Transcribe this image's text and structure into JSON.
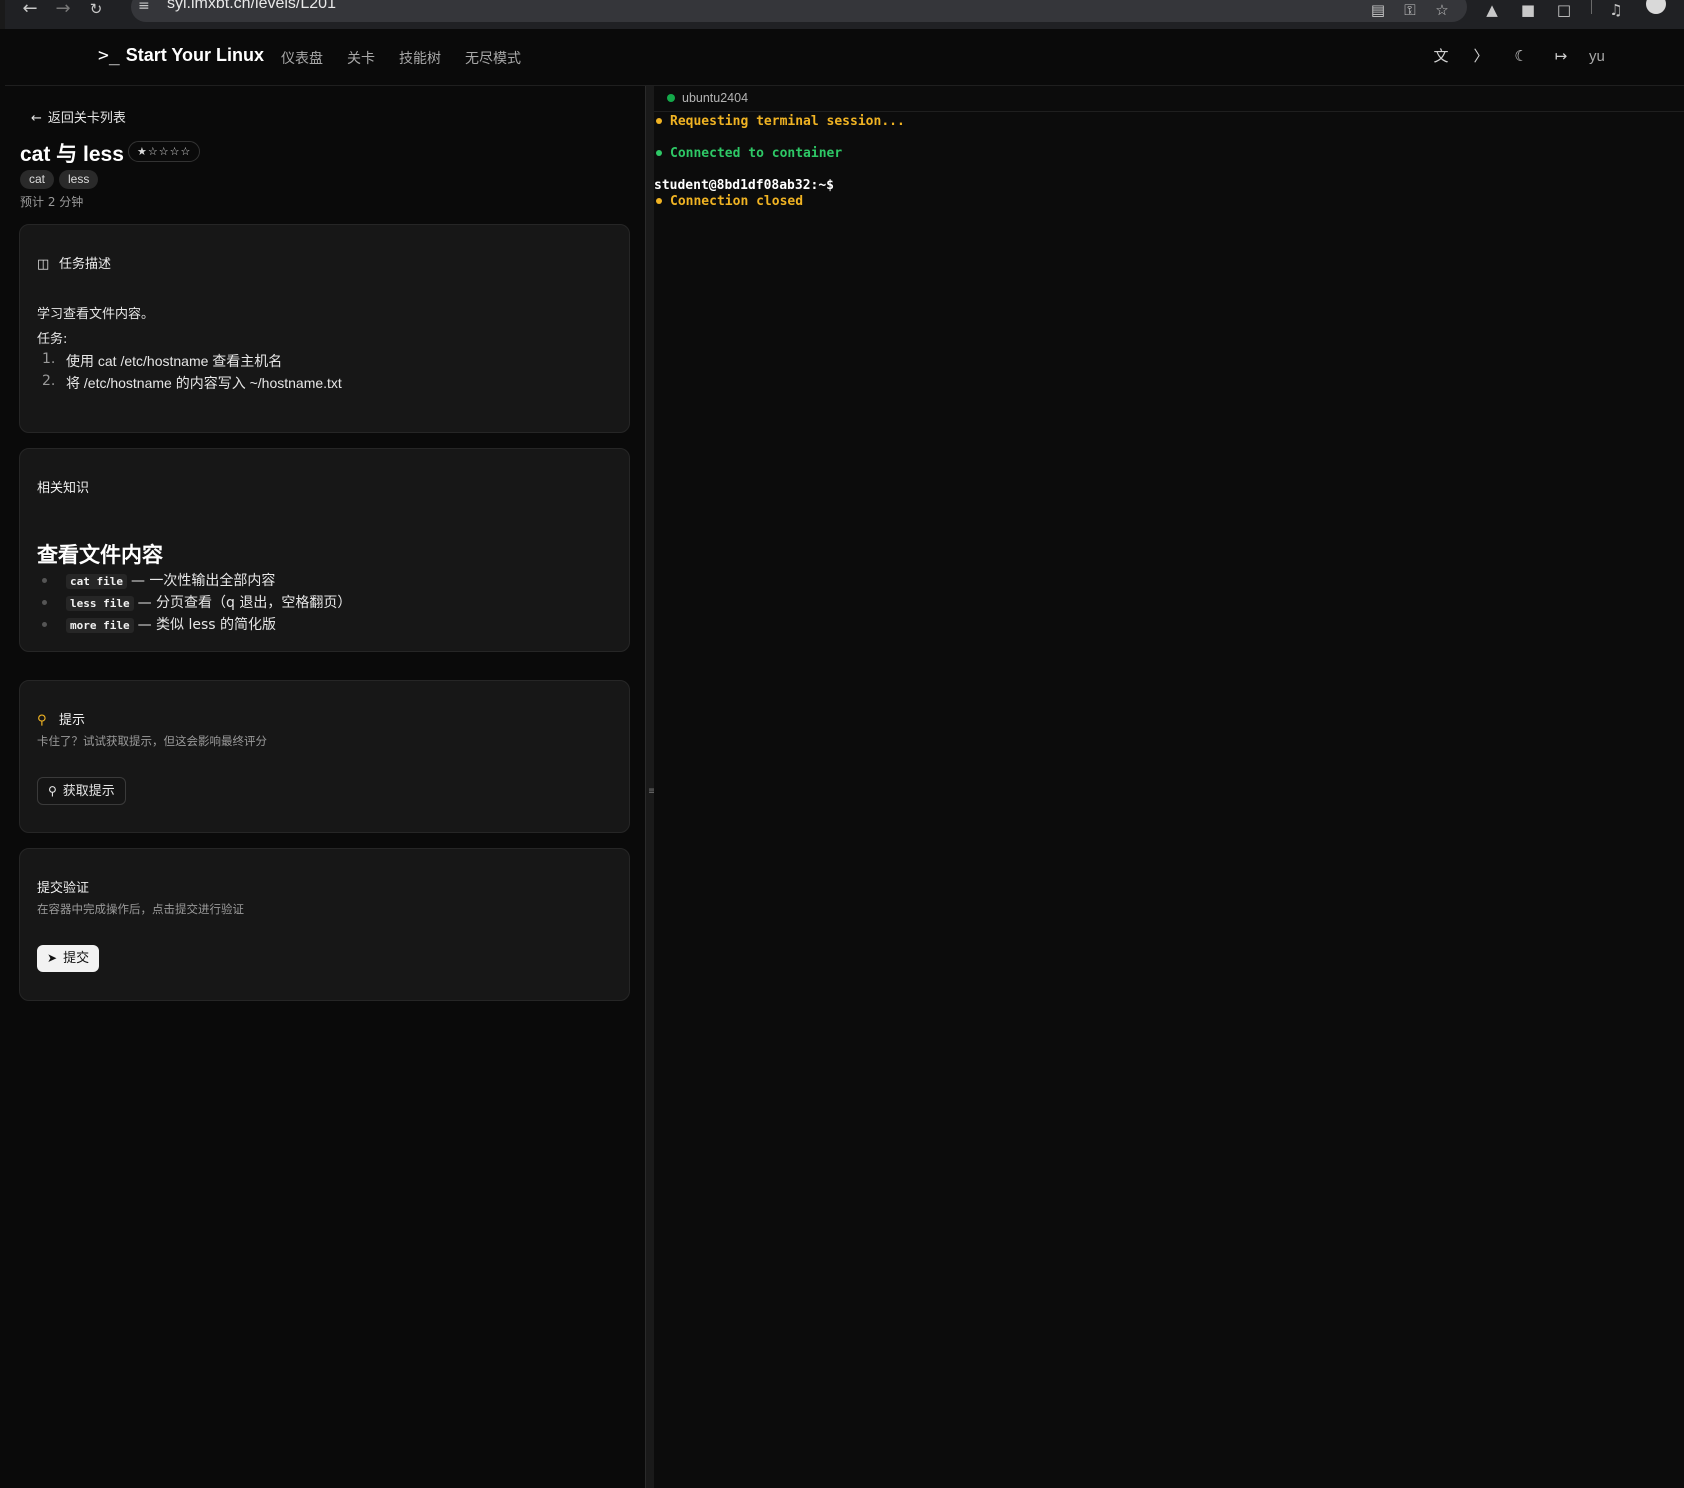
{
  "browser": {
    "url": "syl.imxbt.cn/levels/L201"
  },
  "header": {
    "logo_prompt": ">_",
    "logo_text": "Start Your Linux",
    "nav": [
      "仪表盘",
      "关卡",
      "技能树",
      "无尽模式"
    ],
    "user": "yu"
  },
  "level": {
    "back_label": "返回关卡列表",
    "title": "cat 与 less",
    "difficulty_stars": "★☆☆☆☆",
    "difficulty_value": 1,
    "tags": [
      "cat",
      "less"
    ],
    "estimate": "预计 2 分钟"
  },
  "task": {
    "heading": "任务描述",
    "intro": "学习查看文件内容。",
    "label": "任务:",
    "steps": [
      {
        "num": "1.",
        "text": "使用 cat /etc/hostname 查看主机名"
      },
      {
        "num": "2.",
        "text": "将 /etc/hostname 的内容写入 ~/hostname.txt"
      }
    ]
  },
  "knowledge": {
    "heading": "相关知识",
    "subheading": "查看文件内容",
    "items": [
      {
        "code": "cat file",
        "desc": "— 一次性输出全部内容"
      },
      {
        "code": "less file",
        "desc": "— 分页查看（q 退出，空格翻页）"
      },
      {
        "code": "more file",
        "desc": "— 类似 less 的简化版"
      }
    ]
  },
  "hint": {
    "heading": "提示",
    "desc": "卡住了？试试获取提示，但这会影响最终评分",
    "button": "获取提示"
  },
  "submit": {
    "heading": "提交验证",
    "desc": "在容器中完成操作后，点击提交进行验证",
    "button": "提交"
  },
  "terminal": {
    "container": "ubuntu2404",
    "lines": [
      {
        "type": "status",
        "color": "#f0b323",
        "text": "Requesting terminal session..."
      },
      {
        "type": "status",
        "color": "#2ec866",
        "text": "Connected to container"
      },
      {
        "type": "prompt",
        "text": "student@8bd1df08ab32:~$"
      },
      {
        "type": "status",
        "color": "#f0b323",
        "text": "Connection closed"
      }
    ]
  },
  "colors": {
    "accent_yellow": "#f0b323",
    "accent_green": "#2ec866",
    "background": "#0a0a0a",
    "card": "#171717"
  }
}
